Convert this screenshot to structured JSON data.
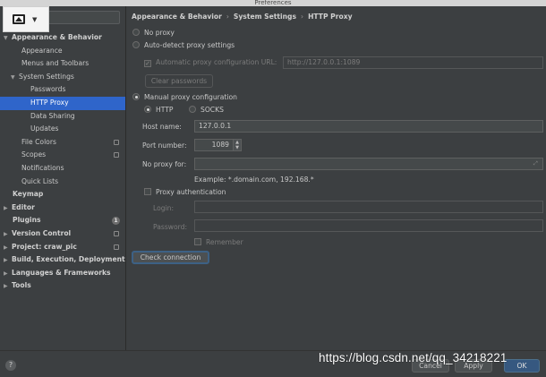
{
  "window": {
    "title": "Preferences"
  },
  "sidebar": {
    "items": [
      {
        "label": "Appearance & Behavior",
        "level": 0,
        "bold": true,
        "arrow": "▼"
      },
      {
        "label": "Appearance",
        "level": 1
      },
      {
        "label": "Menus and Toolbars",
        "level": 1
      },
      {
        "label": "System Settings",
        "level": 1,
        "arrow": "▼"
      },
      {
        "label": "Passwords",
        "level": 2
      },
      {
        "label": "HTTP Proxy",
        "level": 2,
        "selected": true
      },
      {
        "label": "Data Sharing",
        "level": 2
      },
      {
        "label": "Updates",
        "level": 2
      },
      {
        "label": "File Colors",
        "level": 1,
        "icon": "project-scope-icon"
      },
      {
        "label": "Scopes",
        "level": 1,
        "icon": "project-scope-icon"
      },
      {
        "label": "Notifications",
        "level": 1
      },
      {
        "label": "Quick Lists",
        "level": 1
      },
      {
        "label": "Keymap",
        "level": 0,
        "bold": true
      },
      {
        "label": "Editor",
        "level": 0,
        "bold": true,
        "arrow": "▶"
      },
      {
        "label": "Plugins",
        "level": 0,
        "bold": true,
        "badge": "1"
      },
      {
        "label": "Version Control",
        "level": 0,
        "bold": true,
        "arrow": "▶",
        "icon": "project-scope-icon"
      },
      {
        "label": "Project: craw_pic",
        "level": 0,
        "bold": true,
        "arrow": "▶",
        "icon": "project-scope-icon"
      },
      {
        "label": "Build, Execution, Deployment",
        "level": 0,
        "bold": true,
        "arrow": "▶"
      },
      {
        "label": "Languages & Frameworks",
        "level": 0,
        "bold": true,
        "arrow": "▶"
      },
      {
        "label": "Tools",
        "level": 0,
        "bold": true,
        "arrow": "▶"
      }
    ]
  },
  "breadcrumb": [
    "Appearance & Behavior",
    "System Settings",
    "HTTP Proxy"
  ],
  "proxy": {
    "no_proxy_label": "No proxy",
    "auto_detect_label": "Auto-detect proxy settings",
    "auto_config_url_label": "Automatic proxy configuration URL:",
    "auto_config_url_value": "http://127.0.0.1:1089",
    "clear_passwords_label": "Clear passwords",
    "manual_label": "Manual proxy configuration",
    "http_label": "HTTP",
    "socks_label": "SOCKS",
    "host_name_label": "Host name:",
    "host_name_value": "127.0.0.1",
    "port_number_label": "Port number:",
    "port_number_value": "1089",
    "no_proxy_for_label": "No proxy for:",
    "no_proxy_for_value": "",
    "example_text": "Example: *.domain.com, 192.168.*",
    "proxy_auth_label": "Proxy authentication",
    "login_label": "Login:",
    "login_value": "",
    "password_label": "Password:",
    "password_value": "",
    "remember_label": "Remember",
    "check_connection_label": "Check connection",
    "selected_mode": "manual",
    "selected_protocol": "HTTP"
  },
  "footer": {
    "help_label": "?",
    "cancel_label": "Cancel",
    "apply_label": "Apply",
    "ok_label": "OK"
  },
  "watermark": "https://blog.csdn.net/qq_34218221",
  "colors": {
    "background": "#3c3f41",
    "selection": "#2f65ca",
    "field": "#45494a",
    "primary_button": "#365880"
  }
}
